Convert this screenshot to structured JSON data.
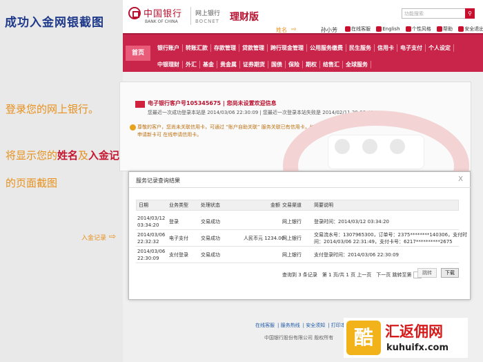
{
  "annotation": {
    "title": "成功入金网银截图",
    "step1": "登录您的网上银行。",
    "step2_pre": "将显示您的",
    "step2_name": "姓名",
    "step2_mid": "及",
    "step2_record": "入金记录",
    "step3": "的页面截图",
    "name_label": "姓名",
    "record_label": "入金记录"
  },
  "header": {
    "bank_cn": "中国银行",
    "bank_en": "BANK OF CHINA",
    "wangshang": "网上银行",
    "bocnet": "BOCNET",
    "edition": "理财版",
    "search_placeholder": "功能搜索",
    "user_name": "孙小芳",
    "links": [
      "在线客服",
      "English",
      "个性风格",
      "帮助",
      "安全退出"
    ]
  },
  "nav": {
    "home": "首页",
    "row1": [
      "银行账户",
      "转账汇款",
      "存款管理",
      "贷款管理",
      "跨行现金管理",
      "公用服务缴费",
      "民生服务",
      "信用卡",
      "电子支付",
      "个人设定"
    ],
    "row2": [
      "中银理财",
      "外汇",
      "基金",
      "贵金属",
      "证券期货",
      "国债",
      "保险",
      "期权",
      "结售汇",
      "全球服务"
    ]
  },
  "welcome": {
    "customer_line": "电子银行客户号105345675 | 您尚未设置欢迎信息",
    "login_line": "您最近一次成功登录本站是 2014/03/06 22:30:09 | 您最近一次登录本站失败是 2014/02/11 20:06:49",
    "notice": "尊敬的客户，您尚未关联信用卡，可通过 “账户自助关联” 服务关联已有信用卡，如需申请新卡可 在线申请信用卡。"
  },
  "dialog": {
    "title": "服务记录查询结果",
    "close": "X",
    "columns": [
      "日期",
      "业务类型",
      "处理状态",
      "金额",
      "交易渠道",
      "简要说明"
    ],
    "rows": [
      {
        "date1": "2014/03/12",
        "date2": "03:34:20",
        "type": "登录",
        "status": "交易成功",
        "amount": "",
        "channel": "网上银行",
        "note1": "登录时间：2014/03/12 03:34:20",
        "note2": ""
      },
      {
        "date1": "2014/03/06",
        "date2": "22:32:32",
        "type": "电子支付",
        "status": "交易成功",
        "amount": "人民币元 1234.00",
        "channel": "网上银行",
        "note1": "交易流水号：1307965300，订单号：2375********140306，支付时",
        "note2": "间：2014/03/06 22:31:49，支付卡号：6217**********2675"
      },
      {
        "date1": "2014/03/06",
        "date2": "22:30:09",
        "type": "支付登录",
        "status": "交易成功",
        "amount": "",
        "channel": "网上银行",
        "note1": "支付登录时间：2014/03/06 22:30:09",
        "note2": ""
      }
    ],
    "pager": {
      "summary": "查询到 3 条记录　第 1 页/共 1 页",
      "prev_links": "上一页　下一页",
      "jump_to": "跳转至第",
      "page_unit": "页",
      "jump": "跳转",
      "next": "下载"
    }
  },
  "footer": {
    "links": [
      "在线客服",
      "服务热线",
      "安全须知",
      "打印本页"
    ],
    "copyright": "中国银行股份有限公司 版权所有"
  },
  "watermark": {
    "cn": "汇返佣网",
    "url": "kuhuifx.com",
    "logo_char": "酷"
  }
}
